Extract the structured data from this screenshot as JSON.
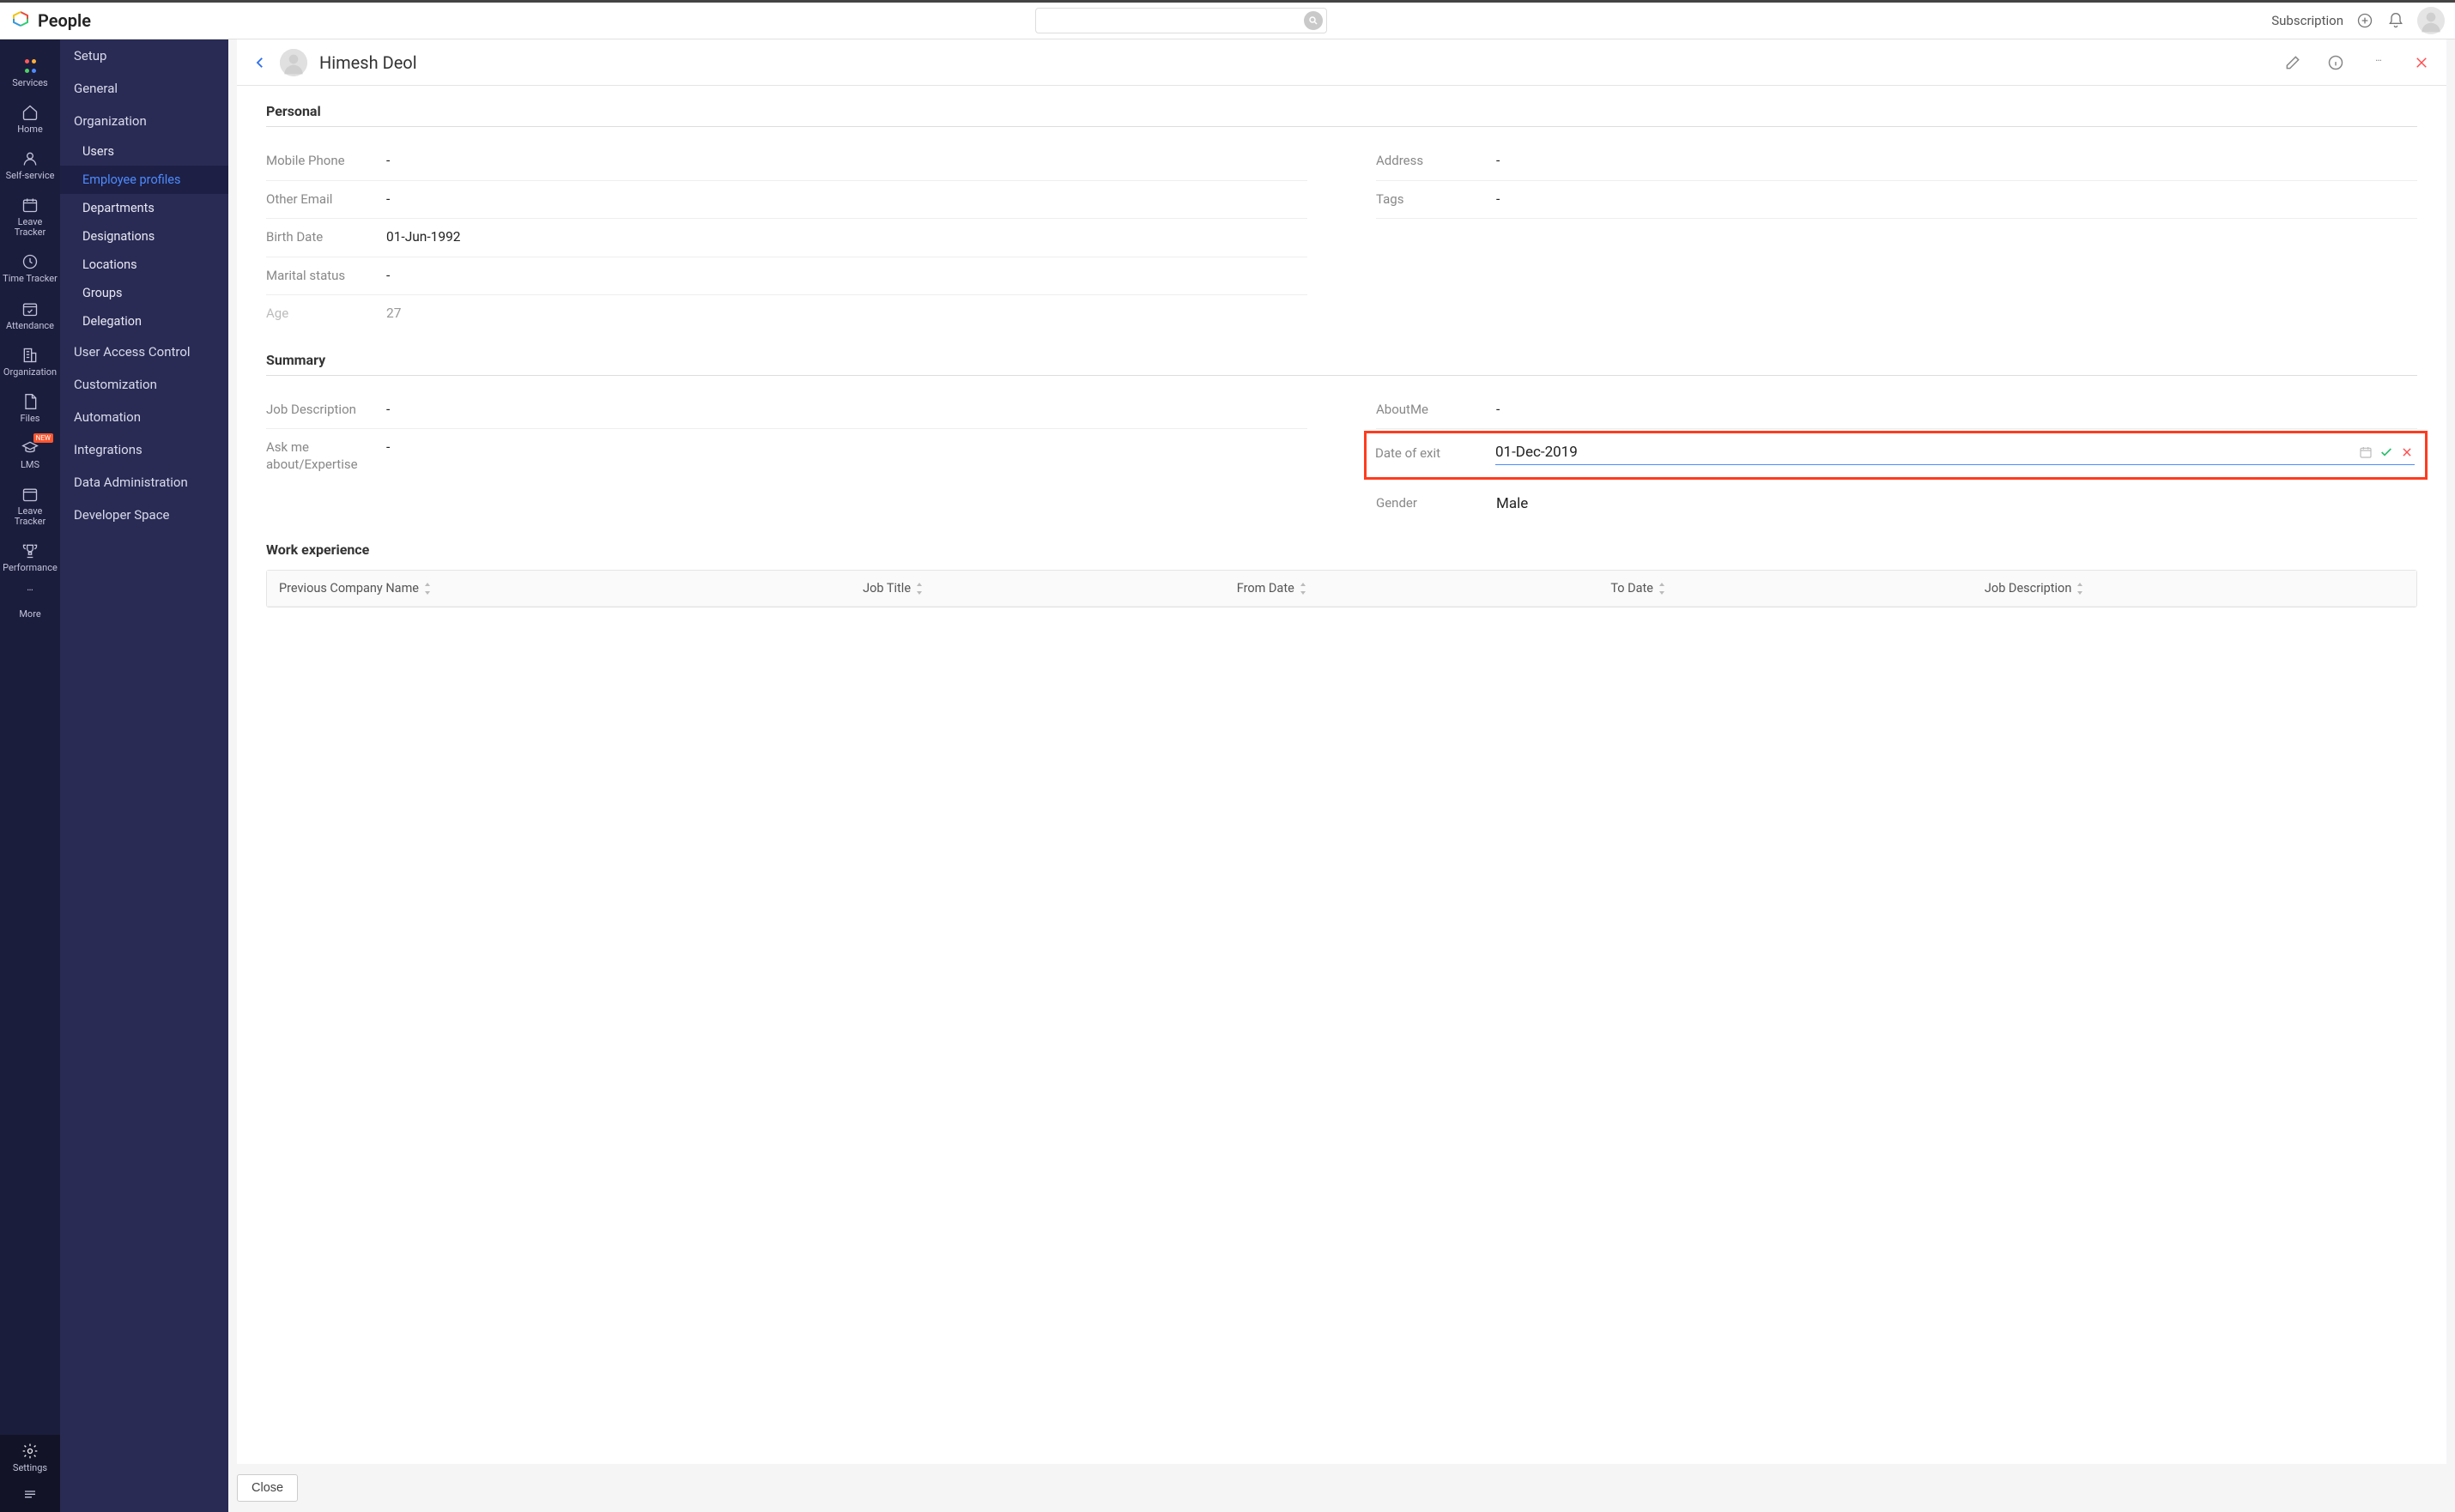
{
  "brand": {
    "title": "People"
  },
  "topbar": {
    "search_placeholder": "",
    "subscription": "Subscription"
  },
  "rail": {
    "services": "Services",
    "home": "Home",
    "self_service": "Self-service",
    "leave_tracker": "Leave Tracker",
    "time_tracker": "Time Tracker",
    "attendance": "Attendance",
    "organization": "Organization",
    "files": "Files",
    "lms": "LMS",
    "lms_badge": "NEW",
    "leave_tracker2": "Leave Tracker",
    "performance": "Performance",
    "more": "More",
    "settings": "Settings"
  },
  "subnav": {
    "setup": "Setup",
    "general": "General",
    "organization": "Organization",
    "users": "Users",
    "employee_profiles": "Employee profiles",
    "departments": "Departments",
    "designations": "Designations",
    "locations": "Locations",
    "groups": "Groups",
    "delegation": "Delegation",
    "user_access_control": "User Access Control",
    "customization": "Customization",
    "automation": "Automation",
    "integrations": "Integrations",
    "data_administration": "Data Administration",
    "developer_space": "Developer Space"
  },
  "header": {
    "name": "Himesh Deol"
  },
  "personal": {
    "title": "Personal",
    "mobile_phone": {
      "label": "Mobile Phone",
      "value": "-"
    },
    "other_email": {
      "label": "Other Email",
      "value": "-"
    },
    "birth_date": {
      "label": "Birth Date",
      "value": "01-Jun-1992"
    },
    "marital_status": {
      "label": "Marital status",
      "value": "-"
    },
    "age": {
      "label": "Age",
      "value": "27"
    },
    "address": {
      "label": "Address",
      "value": "-"
    },
    "tags": {
      "label": "Tags",
      "value": "-"
    }
  },
  "summary": {
    "title": "Summary",
    "job_description": {
      "label": "Job Description",
      "value": "-"
    },
    "expertise": {
      "label": "Ask me about/Expertise",
      "value": "-"
    },
    "about_me": {
      "label": "AboutMe",
      "value": "-"
    },
    "date_of_exit": {
      "label": "Date of exit",
      "value": "01-Dec-2019"
    },
    "gender": {
      "label": "Gender",
      "value": "Male"
    }
  },
  "work_experience": {
    "title": "Work experience",
    "cols": {
      "company": "Previous Company Name",
      "job_title": "Job Title",
      "from_date": "From Date",
      "to_date": "To Date",
      "job_desc": "Job Description"
    }
  },
  "footer": {
    "close": "Close"
  }
}
